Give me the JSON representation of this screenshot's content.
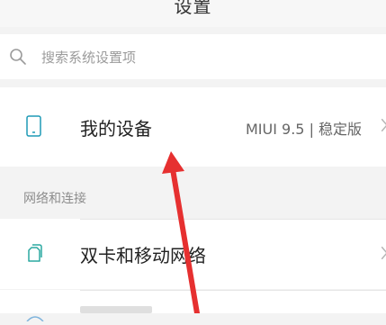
{
  "header": {
    "title": "设置"
  },
  "search": {
    "placeholder": "搜索系统设置项",
    "icon": "search-icon"
  },
  "device_row": {
    "label": "我的设备",
    "value": "MIUI 9.5 | 稳定版",
    "icon": "phone-icon"
  },
  "network_section": {
    "title": "网络和连接",
    "items": [
      {
        "label": "双卡和移动网络",
        "icon": "sim-card-icon"
      }
    ]
  },
  "annotation": {
    "color": "#e63030"
  }
}
